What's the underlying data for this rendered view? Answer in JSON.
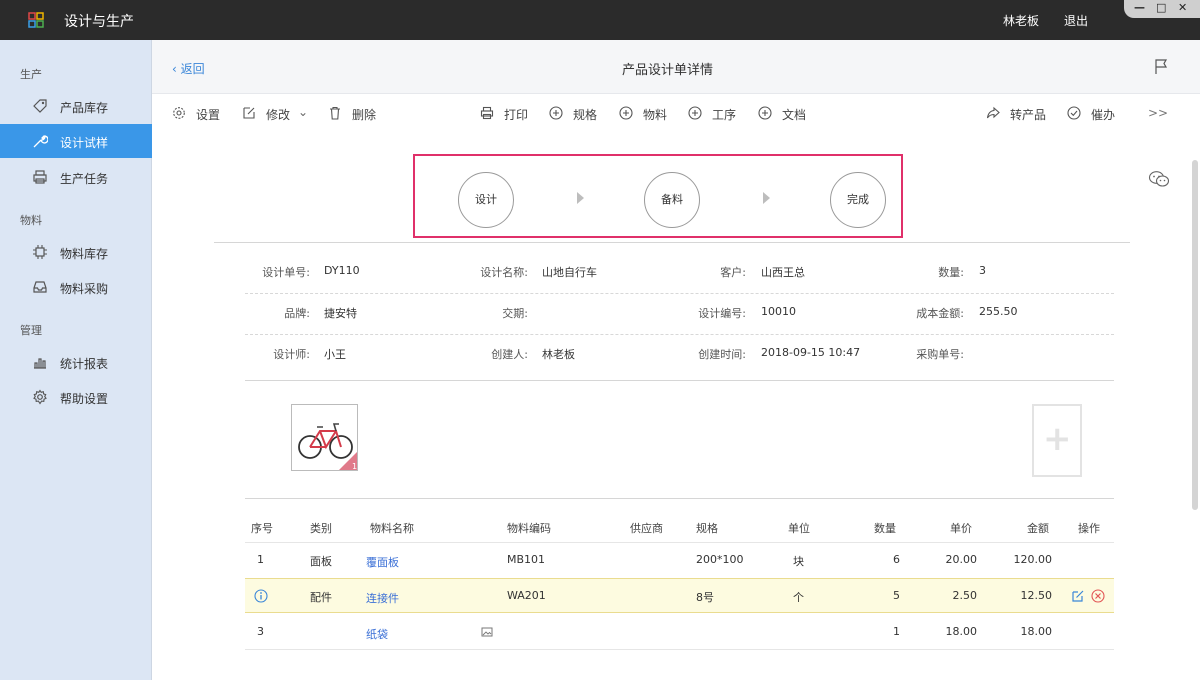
{
  "window": {
    "app_title": "设计与生产",
    "user_name": "林老板",
    "logout_label": "退出",
    "controls": [
      "—",
      "□",
      "✕"
    ]
  },
  "sidebar": {
    "sections": [
      {
        "label": "生产",
        "items": [
          {
            "label": "产品库存",
            "icon": "tag-icon"
          },
          {
            "label": "设计试样",
            "icon": "wrench-icon",
            "active": true
          },
          {
            "label": "生产任务",
            "icon": "printer-icon"
          }
        ]
      },
      {
        "label": "物料",
        "items": [
          {
            "label": "物料库存",
            "icon": "chip-icon"
          },
          {
            "label": "物料采购",
            "icon": "inbox-icon"
          }
        ]
      },
      {
        "label": "管理",
        "items": [
          {
            "label": "统计报表",
            "icon": "bar-chart-icon"
          },
          {
            "label": "帮助设置",
            "icon": "gear-icon"
          }
        ]
      }
    ]
  },
  "header": {
    "back_label": "返回",
    "title": "产品设计单详情"
  },
  "toolbar": {
    "settings": "设置",
    "edit": "修改",
    "delete": "删除",
    "print": "打印",
    "spec": "规格",
    "material": "物料",
    "process": "工序",
    "document": "文档",
    "to_product": "转产品",
    "urge": "催办",
    "more": ">>"
  },
  "workflow": {
    "steps": [
      "设计",
      "备料",
      "完成"
    ]
  },
  "info": {
    "rows": [
      [
        {
          "label": "设计单号:",
          "value": "DY110"
        },
        {
          "label": "设计名称:",
          "value": "山地自行车"
        },
        {
          "label": "客户:",
          "value": "山西王总"
        },
        {
          "label": "数量:",
          "value": "3"
        }
      ],
      [
        {
          "label": "品牌:",
          "value": "捷安特"
        },
        {
          "label": "交期:",
          "value": ""
        },
        {
          "label": "设计编号:",
          "value": "10010"
        },
        {
          "label": "成本金额:",
          "value": "255.50"
        }
      ],
      [
        {
          "label": "设计师:",
          "value": "小王"
        },
        {
          "label": "创建人:",
          "value": "林老板"
        },
        {
          "label": "创建时间:",
          "value": "2018-09-15 10:47"
        },
        {
          "label": "采购单号:",
          "value": ""
        }
      ]
    ]
  },
  "images": {
    "thumb_badge": "1",
    "add_symbol": "+"
  },
  "table": {
    "headers": [
      "序号",
      "类别",
      "物料名称",
      "物料编码",
      "供应商",
      "规格",
      "单位",
      "数量",
      "单价",
      "金额",
      "操作"
    ],
    "rows": [
      {
        "index": "1",
        "category": "面板",
        "name": "覆面板",
        "code": "MB101",
        "supplier": "",
        "spec": "200*100",
        "unit": "块",
        "qty": "6",
        "price": "20.00",
        "amount": "120.00"
      },
      {
        "index": "",
        "category": "配件",
        "name": "连接件",
        "code": "WA201",
        "supplier": "",
        "spec": "8号",
        "unit": "个",
        "qty": "5",
        "price": "2.50",
        "amount": "12.50"
      },
      {
        "index": "3",
        "category": "",
        "name": "纸袋",
        "code": "",
        "supplier": "",
        "spec": "",
        "unit": "",
        "qty": "1",
        "price": "18.00",
        "amount": "18.00"
      }
    ]
  },
  "colors": {
    "titlebar": "#2b2b2b",
    "sidebar": "#dce6f4",
    "active_nav": "#3a97e8",
    "workflow_border": "#e0306a",
    "link": "#3a6fd6",
    "highlight_row": "#fdfbe0"
  }
}
